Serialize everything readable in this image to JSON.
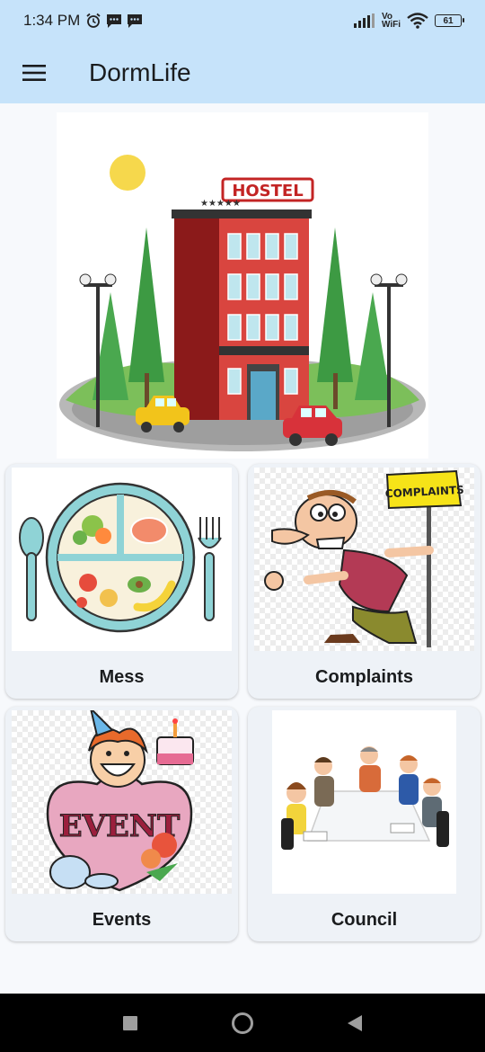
{
  "status_bar": {
    "time": "1:34 PM",
    "icons": [
      "alarm-icon",
      "message-icon",
      "message-icon"
    ],
    "network": "Vo WiFi",
    "vo_text": "Vo",
    "wifi_text": "WiFi",
    "battery": "61"
  },
  "app_bar": {
    "title": "DormLife",
    "menu_icon": "hamburger-menu-icon"
  },
  "hero": {
    "sign_text": "HOSTEL"
  },
  "cards": [
    {
      "label": "Mess",
      "icon": "meal-plate-image"
    },
    {
      "label": "Complaints",
      "icon": "complaints-cartoon-image",
      "sign_text": "COMPLAINTS"
    },
    {
      "label": "Events",
      "icon": "event-cartoon-image",
      "sign_text": "EVENT"
    },
    {
      "label": "Council",
      "icon": "council-meeting-image"
    }
  ],
  "nav_bar": {
    "buttons": [
      "recents-square-icon",
      "home-circle-icon",
      "back-triangle-icon"
    ]
  },
  "colors": {
    "app_bar": "#c6e3fa",
    "card_bg": "#eef2f7",
    "page_bg": "#f7f9fc"
  }
}
